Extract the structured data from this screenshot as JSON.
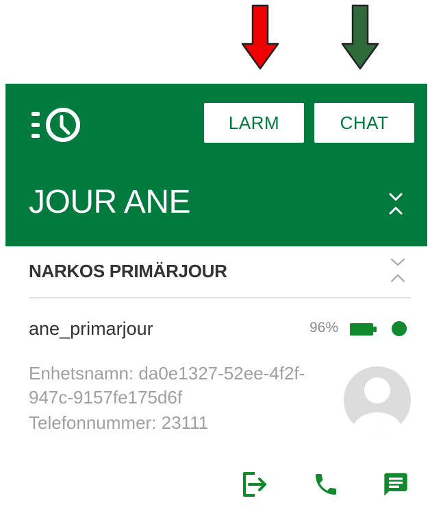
{
  "annotations": {
    "arrow_left_color": "#ee0000",
    "arrow_right_color": "#2f6b3a"
  },
  "header": {
    "background": "#007a3d",
    "logo_icon": "list-clock-icon",
    "larm_label": "LARM",
    "chat_label": "CHAT",
    "title": "JOUR ANE",
    "toggle_icon": "collapse-chevrons-icon"
  },
  "section": {
    "title": "NARKOS PRIMÄRJOUR",
    "toggle_icon": "collapse-chevrons-icon"
  },
  "user": {
    "username": "ane_primarjour",
    "battery_percent": "96%",
    "battery_color": "#108a2c",
    "status_color": "#108a2c",
    "device_line1": "Enhetsnamn: da0e1327-52ee-4f2f-",
    "device_line2": "947c-9157fe175d6f",
    "phone_line": "Telefonnummer: 23111",
    "avatar_icon": "person-avatar-icon"
  },
  "actions": [
    {
      "icon": "logout-icon"
    },
    {
      "icon": "phone-icon"
    },
    {
      "icon": "chat-message-icon"
    }
  ]
}
